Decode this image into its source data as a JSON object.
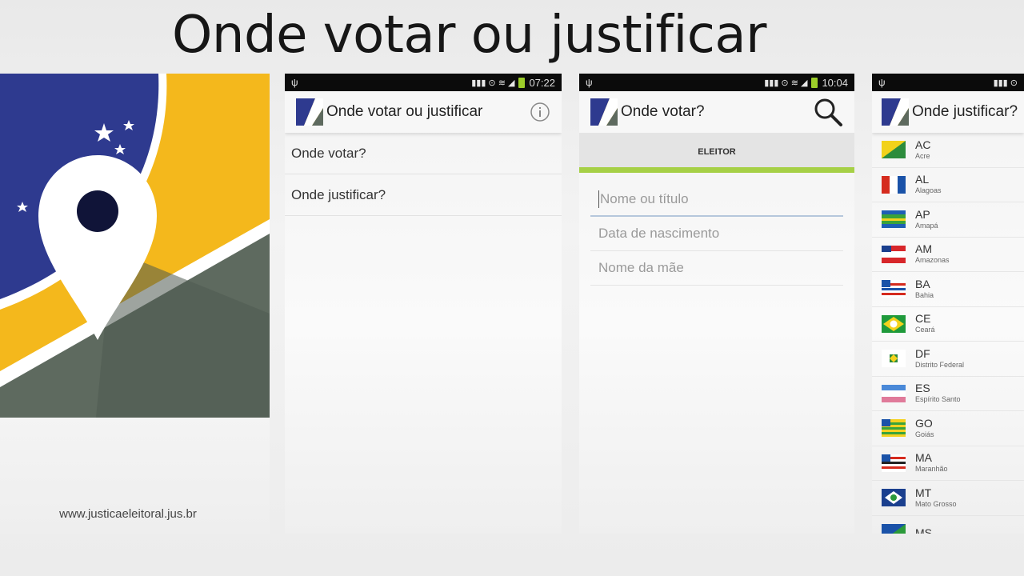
{
  "headline": "Onde votar ou justificar",
  "splash": {
    "url": "www.justicaeleitoral.jus.br"
  },
  "screen_main": {
    "status_time": "07:22",
    "title": "Onde votar ou justificar",
    "info_icon": "info-icon",
    "menu": [
      "Onde votar?",
      "Onde justificar?"
    ]
  },
  "screen_votar": {
    "status_time": "10:04",
    "title": "Onde votar?",
    "search_icon": "search-icon",
    "tab": "ELEITOR",
    "fields": {
      "name_placeholder": "Nome ou título",
      "birth_placeholder": "Data de nascimento",
      "mother_placeholder": "Nome da mãe"
    }
  },
  "screen_justificar": {
    "title": "Onde justificar?",
    "states": [
      {
        "abbr": "AC",
        "name": "Acre"
      },
      {
        "abbr": "AL",
        "name": "Alagoas"
      },
      {
        "abbr": "AP",
        "name": "Amapá"
      },
      {
        "abbr": "AM",
        "name": "Amazonas"
      },
      {
        "abbr": "BA",
        "name": "Bahia"
      },
      {
        "abbr": "CE",
        "name": "Ceará"
      },
      {
        "abbr": "DF",
        "name": "Distrito Federal"
      },
      {
        "abbr": "ES",
        "name": "Espírito Santo"
      },
      {
        "abbr": "GO",
        "name": "Goiás"
      },
      {
        "abbr": "MA",
        "name": "Maranhão"
      },
      {
        "abbr": "MT",
        "name": "Mato Grosso"
      },
      {
        "abbr": "MS",
        "name": ""
      }
    ]
  },
  "colors": {
    "brand_blue": "#2e3a8f",
    "brand_yellow": "#f4b81c",
    "brand_gray": "#5e6a5f",
    "accent_green": "#a6d046",
    "statusbar": "#0b0b0b"
  }
}
